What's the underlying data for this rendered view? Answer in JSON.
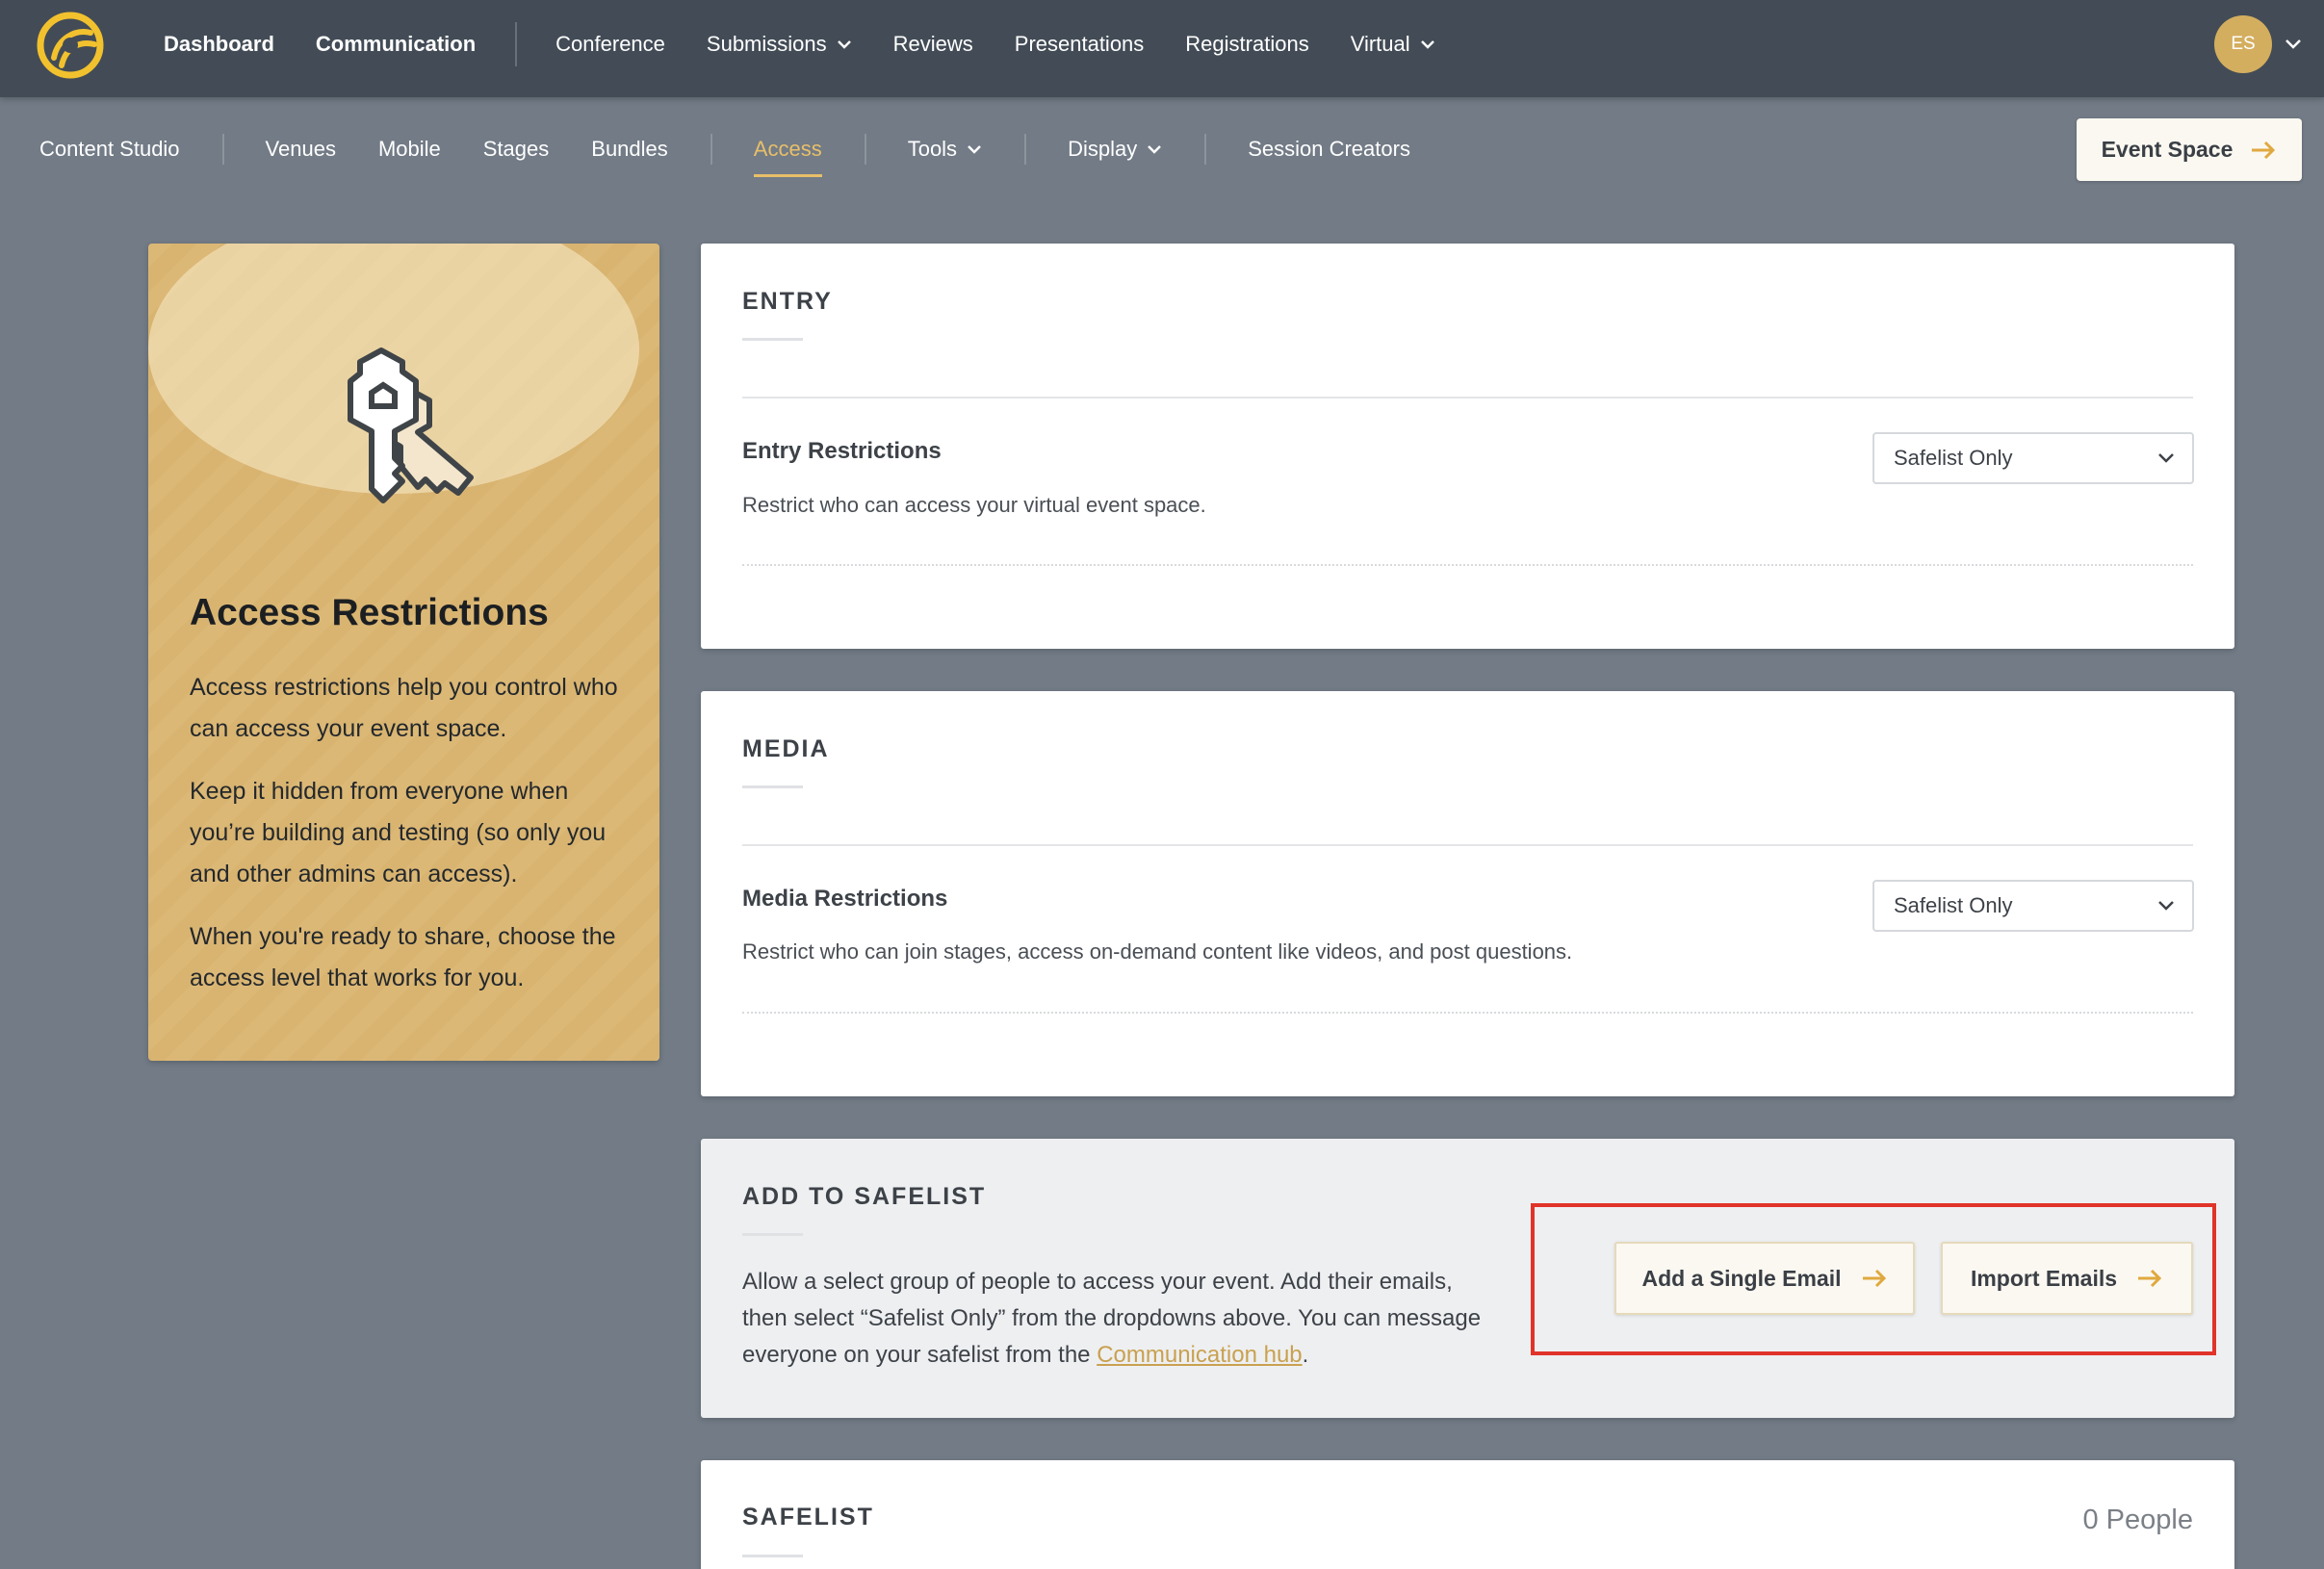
{
  "topbar": {
    "items": [
      {
        "label": "Dashboard"
      },
      {
        "label": "Communication"
      },
      {
        "label": "Conference"
      },
      {
        "label": "Submissions"
      },
      {
        "label": "Reviews"
      },
      {
        "label": "Presentations"
      },
      {
        "label": "Registrations"
      },
      {
        "label": "Virtual"
      }
    ],
    "avatar_initials": "ES"
  },
  "subnav": {
    "items": [
      {
        "label": "Content Studio"
      },
      {
        "label": "Venues"
      },
      {
        "label": "Mobile"
      },
      {
        "label": "Stages"
      },
      {
        "label": "Bundles"
      },
      {
        "label": "Access"
      },
      {
        "label": "Tools"
      },
      {
        "label": "Display"
      },
      {
        "label": "Session Creators"
      }
    ],
    "active": "Access",
    "event_space_label": "Event Space"
  },
  "side_card": {
    "title": "Access Restrictions",
    "paragraphs": [
      "Access restrictions help you control who can access your event space.",
      "Keep it hidden from everyone when you’re building and testing (so only you and other admins can access).",
      "When you're ready to share, choose the access level that works for you."
    ]
  },
  "entry": {
    "heading": "ENTRY",
    "label": "Entry Restrictions",
    "description": "Restrict who can access your virtual event space.",
    "selected": "Safelist Only"
  },
  "media": {
    "heading": "MEDIA",
    "label": "Media Restrictions",
    "description": "Restrict who can join stages, access on-demand content like videos, and post questions.",
    "selected": "Safelist Only"
  },
  "add_safelist": {
    "heading": "ADD TO SAFELIST",
    "text_before": "Allow a select group of people to access your event. Add their emails, then select “Safelist Only” from the dropdowns above. You can message everyone on your safelist from the ",
    "link": "Communication hub",
    "text_after": ".",
    "add_single_label": "Add a Single Email",
    "import_label": "Import Emails"
  },
  "safelist": {
    "heading": "SAFELIST",
    "count": "0 People"
  },
  "colors": {
    "topbar": "#434c56",
    "background": "#727b86",
    "accent": "#e8bf6a",
    "highlight": "#e0342a"
  }
}
